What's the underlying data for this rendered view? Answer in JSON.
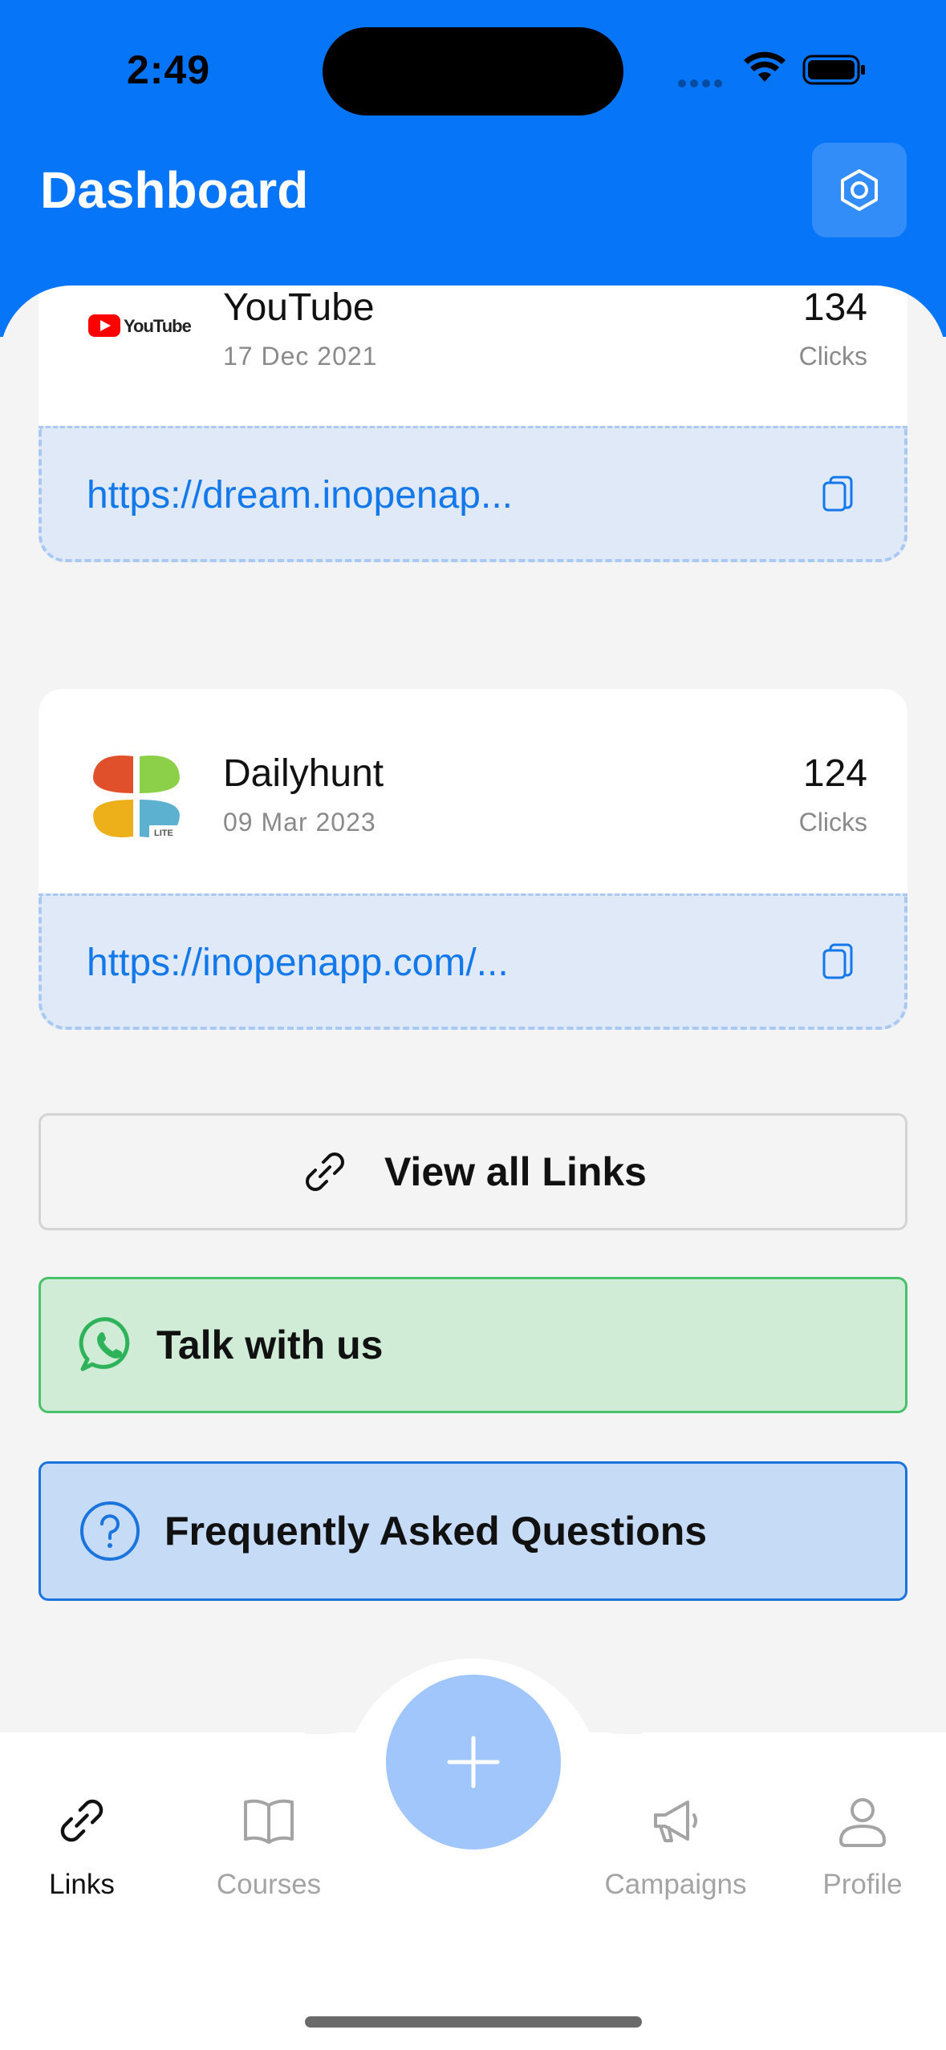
{
  "status": {
    "time": "2:49"
  },
  "header": {
    "title": "Dashboard",
    "settings_icon": "hexagon-settings-icon"
  },
  "links": [
    {
      "name": "YouTube",
      "date": "17 Dec 2021",
      "clicks": "134",
      "clicks_label": "Clicks",
      "url": "https://dream.inopenap...",
      "logo": "youtube-logo"
    },
    {
      "name": "Dailyhunt",
      "date": "09 Mar 2023",
      "clicks": "124",
      "clicks_label": "Clicks",
      "url": "https://inopenapp.com/...",
      "logo": "dailyhunt-logo"
    }
  ],
  "actions": {
    "view_all": "View all Links",
    "talk": "Talk with us",
    "faq": "Frequently Asked Questions"
  },
  "tabs": [
    {
      "label": "Links",
      "icon": "link-icon",
      "active": true
    },
    {
      "label": "Courses",
      "icon": "book-icon",
      "active": false
    },
    {
      "label": "Campaigns",
      "icon": "megaphone-icon",
      "active": false
    },
    {
      "label": "Profile",
      "icon": "person-icon",
      "active": false
    }
  ],
  "colors": {
    "primary": "#0775f7",
    "fab": "#a1c6fb",
    "whatsapp": "#49c06a",
    "faq_border": "#1b73de"
  }
}
